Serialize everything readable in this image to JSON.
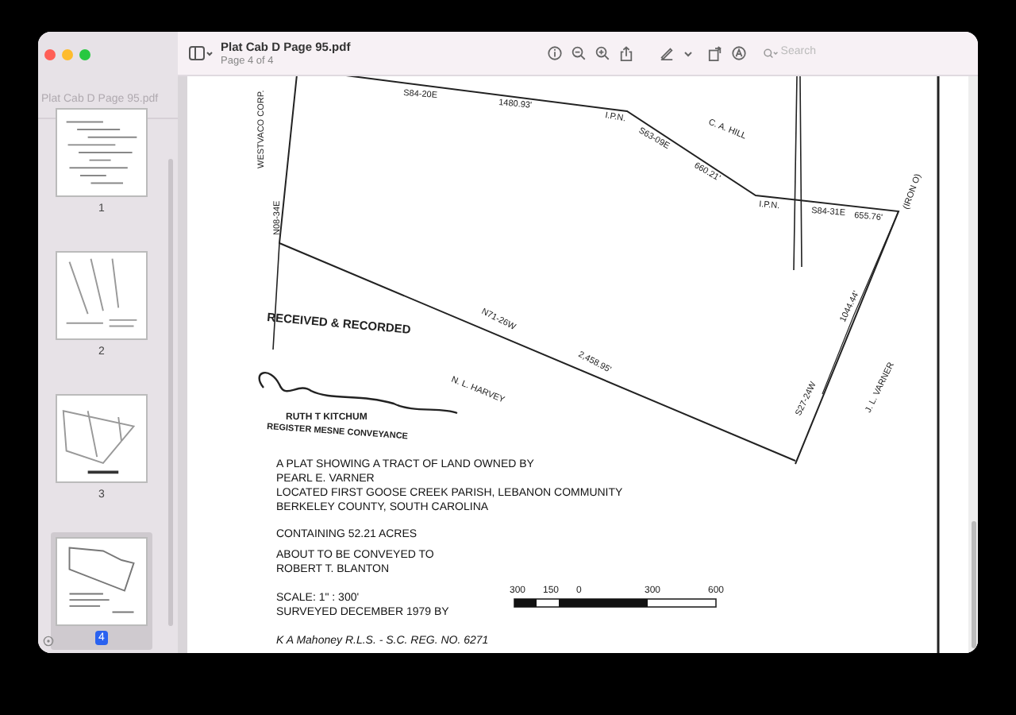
{
  "window": {
    "title": "Plat Cab D Page 95.pdf",
    "subtitle": "Page 4 of 4"
  },
  "sidebar": {
    "title": "Plat Cab D Page 95.pdf",
    "pages": [
      {
        "label": "1",
        "selected": false
      },
      {
        "label": "2",
        "selected": false
      },
      {
        "label": "3",
        "selected": false
      },
      {
        "label": "4",
        "selected": true
      }
    ]
  },
  "toolbar": {
    "search": {
      "placeholder": "Search"
    }
  },
  "document": {
    "plat_labels": [
      "WESTVACO CORP.",
      "N08-34E",
      "S84-20E",
      "1480.93'",
      "I.P.N.",
      "S63-09E",
      "660.21'",
      "C. A. HILL",
      "I.P.N.",
      "S84-31E",
      "655.76'",
      "(IRON O)",
      "N71-26W",
      "2,458.95'",
      "N. L. HARVEY",
      "S27-24W",
      "1044.44'",
      "J. L. VARNER"
    ],
    "stamp": [
      "RECEIVED & RECORDED",
      "RUTH T KITCHUM",
      "REGISTER MESNE CONVEYANCE"
    ],
    "title_block": [
      "A PLAT SHOWING A TRACT OF LAND OWNED BY",
      "PEARL E. VARNER",
      "LOCATED FIRST GOOSE CREEK PARISH, LEBANON COMMUNITY",
      "BERKELEY COUNTY, SOUTH CAROLINA",
      "CONTAINING 52.21 ACRES",
      "ABOUT TO BE CONVEYED TO",
      "ROBERT T. BLANTON",
      "SCALE: 1\" : 300'",
      "SURVEYED DECEMBER 1979 BY",
      "K A Mahoney R.L.S. - S.C. REG. NO. 6271"
    ],
    "scale_labels": [
      "300",
      "150",
      "0",
      "300",
      "600"
    ]
  }
}
